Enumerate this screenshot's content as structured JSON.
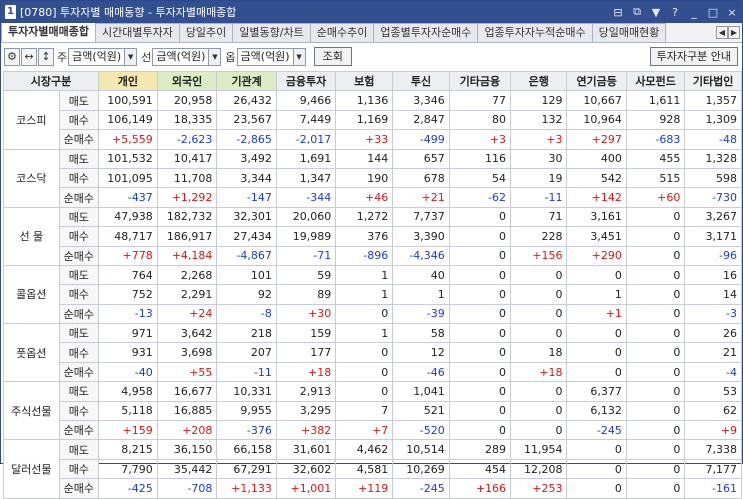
{
  "window": {
    "screen_id": "1",
    "code": "[0780]",
    "title": "투자자별 매매동향 - 투자자별매매종합",
    "controls": [
      "⊟",
      "⧉",
      "▼",
      "?",
      "_",
      "□",
      "×"
    ]
  },
  "tabs": [
    {
      "label": "투자자별매매종합",
      "active": true
    },
    {
      "label": "시간대별투자자",
      "active": false
    },
    {
      "label": "당일추이",
      "active": false
    },
    {
      "label": "일별동향/차트",
      "active": false
    },
    {
      "label": "순매수추이",
      "active": false
    },
    {
      "label": "업종별투자자순매수",
      "active": false
    },
    {
      "label": "업종투자자누적순매수",
      "active": false
    },
    {
      "label": "당일매매현황",
      "active": false
    }
  ],
  "tab_scroll": {
    "left": "◀",
    "right": "▶"
  },
  "toolbar": {
    "icons": [
      "⚙",
      "↔",
      "↕"
    ],
    "filters": [
      {
        "label": "주",
        "value": "금액(억원)"
      },
      {
        "label": "선",
        "value": "금액(억원)"
      },
      {
        "label": "옵",
        "value": "금액(억원)"
      }
    ],
    "query_label": "조회",
    "guide_label": "투자자구분 안내"
  },
  "table": {
    "headers": [
      "시장구분",
      "개인",
      "외국인",
      "기관계",
      "금융투자",
      "보험",
      "투신",
      "기타금융",
      "은행",
      "연기금등",
      "사모펀드",
      "기타법인"
    ],
    "row_kinds": [
      "매도",
      "매수",
      "순매수"
    ],
    "markets": [
      {
        "name": "코스피",
        "rows": [
          [
            "100,591",
            "20,958",
            "26,432",
            "9,466",
            "1,136",
            "3,346",
            "77",
            "129",
            "10,667",
            "1,611",
            "1,357"
          ],
          [
            "106,149",
            "18,335",
            "23,567",
            "7,449",
            "1,169",
            "2,847",
            "80",
            "132",
            "10,964",
            "928",
            "1,309"
          ],
          [
            "+5,559",
            "-2,623",
            "-2,865",
            "-2,017",
            "+33",
            "-499",
            "+3",
            "+3",
            "+297",
            "-683",
            "-48"
          ]
        ]
      },
      {
        "name": "코스닥",
        "rows": [
          [
            "101,532",
            "10,417",
            "3,492",
            "1,691",
            "144",
            "657",
            "116",
            "30",
            "400",
            "455",
            "1,328"
          ],
          [
            "101,095",
            "11,708",
            "3,344",
            "1,347",
            "190",
            "678",
            "54",
            "19",
            "542",
            "515",
            "598"
          ],
          [
            "-437",
            "+1,292",
            "-147",
            "-344",
            "+46",
            "+21",
            "-62",
            "-11",
            "+142",
            "+60",
            "-730"
          ]
        ]
      },
      {
        "name": "선 물",
        "rows": [
          [
            "47,938",
            "182,732",
            "32,301",
            "20,060",
            "1,272",
            "7,737",
            "0",
            "71",
            "3,161",
            "0",
            "3,267"
          ],
          [
            "48,717",
            "186,917",
            "27,434",
            "19,989",
            "376",
            "3,390",
            "0",
            "228",
            "3,451",
            "0",
            "3,171"
          ],
          [
            "+778",
            "+4,184",
            "-4,867",
            "-71",
            "-896",
            "-4,346",
            "0",
            "+156",
            "+290",
            "0",
            "-96"
          ]
        ]
      },
      {
        "name": "콜옵션",
        "rows": [
          [
            "764",
            "2,268",
            "101",
            "59",
            "1",
            "40",
            "0",
            "0",
            "0",
            "0",
            "16"
          ],
          [
            "752",
            "2,291",
            "92",
            "89",
            "1",
            "1",
            "0",
            "0",
            "1",
            "0",
            "14"
          ],
          [
            "-13",
            "+24",
            "-8",
            "+30",
            "0",
            "-39",
            "0",
            "0",
            "+1",
            "0",
            "-3"
          ]
        ]
      },
      {
        "name": "풋옵션",
        "rows": [
          [
            "971",
            "3,642",
            "218",
            "159",
            "1",
            "58",
            "0",
            "0",
            "0",
            "0",
            "26"
          ],
          [
            "931",
            "3,698",
            "207",
            "177",
            "0",
            "12",
            "0",
            "18",
            "0",
            "0",
            "21"
          ],
          [
            "-40",
            "+55",
            "-11",
            "+18",
            "0",
            "-46",
            "0",
            "+18",
            "0",
            "0",
            "-4"
          ]
        ]
      },
      {
        "name": "주식선물",
        "rows": [
          [
            "4,958",
            "16,677",
            "10,331",
            "2,913",
            "0",
            "1,041",
            "0",
            "0",
            "6,377",
            "0",
            "53"
          ],
          [
            "5,118",
            "16,885",
            "9,955",
            "3,295",
            "7",
            "521",
            "0",
            "0",
            "6,132",
            "0",
            "62"
          ],
          [
            "+159",
            "+208",
            "-376",
            "+382",
            "+7",
            "-520",
            "0",
            "0",
            "-245",
            "0",
            "+9"
          ]
        ]
      },
      {
        "name": "달러선물",
        "rows": [
          [
            "8,215",
            "36,150",
            "66,158",
            "31,601",
            "4,462",
            "10,514",
            "289",
            "11,954",
            "0",
            "0",
            "7,338"
          ],
          [
            "7,790",
            "35,442",
            "67,291",
            "32,602",
            "4,581",
            "10,269",
            "454",
            "12,208",
            "0",
            "0",
            "7,177"
          ],
          [
            "-425",
            "-708",
            "+1,133",
            "+1,001",
            "+119",
            "-245",
            "+166",
            "+253",
            "0",
            "0",
            "-161"
          ]
        ]
      }
    ]
  },
  "colors": {
    "titlebar": "#32508f",
    "positive": "#e01414",
    "negative": "#1a3cd4",
    "header_individual": "#f5e7b0",
    "header_foreign": "#dcecc5"
  }
}
